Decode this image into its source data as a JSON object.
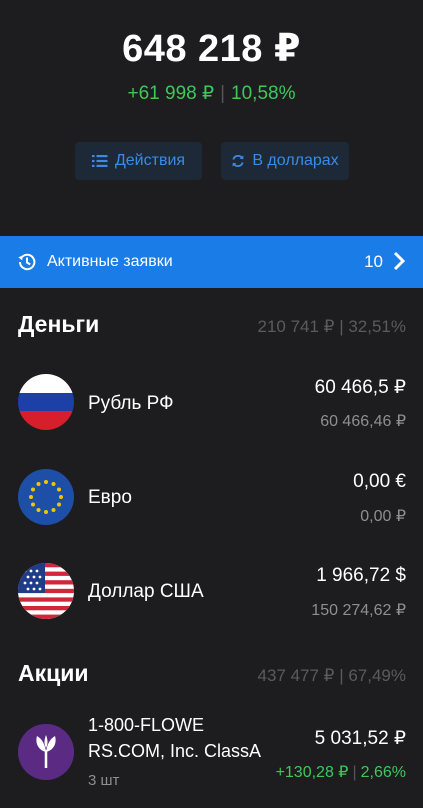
{
  "portfolio": {
    "total": "648 218 ₽",
    "change_abs": "+61 998 ₽",
    "change_sep": "|",
    "change_pct": "10,58%"
  },
  "actions": {
    "actions_label": "Действия",
    "actions_icon": "list-icon",
    "currency_label": "В долларах",
    "currency_icon": "refresh-icon"
  },
  "orders_bar": {
    "label": "Активные заявки",
    "count": "10",
    "icon": "history-icon"
  },
  "money": {
    "title": "Деньги",
    "summary": "210 741 ₽ | 32,51%",
    "items": [
      {
        "name": "Рубль РФ",
        "value": "60 466,5 ₽",
        "value_rub": "60 466,46 ₽",
        "icon": "russia-flag-icon"
      },
      {
        "name": "Евро",
        "value": "0,00 €",
        "value_rub": "0,00 ₽",
        "icon": "eu-flag-icon"
      },
      {
        "name": "Доллар США",
        "value": "1 966,72 $",
        "value_rub": "150 274,62 ₽",
        "icon": "usa-flag-icon"
      }
    ]
  },
  "stocks": {
    "title": "Акции",
    "summary": "437 477 ₽ | 67,49%",
    "items": [
      {
        "name_line1": "1-800-FLOWE",
        "name_line2": "RS.COM, Inc. ClassA",
        "qty": "3 шт",
        "value": "5 031,52 ₽",
        "change_abs": "+130,28 ₽",
        "change_sep": "|",
        "change_pct": "2,66%",
        "icon": "flowers-logo-icon"
      }
    ]
  },
  "colors": {
    "background": "#1d1d1f",
    "accent_blue": "#1a7ce6",
    "positive_green": "#3ec85a",
    "muted_text": "#5b5b5e"
  }
}
